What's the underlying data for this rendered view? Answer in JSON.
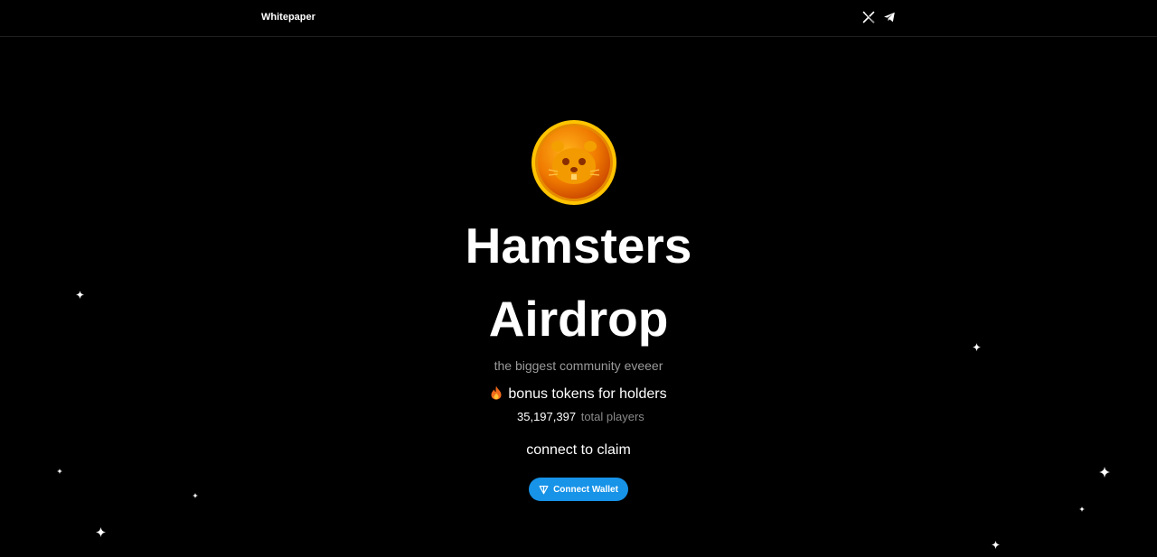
{
  "nav": {
    "whitepaper_label": "Whitepaper",
    "social": [
      {
        "icon": "x-icon"
      },
      {
        "icon": "telegram-icon"
      }
    ]
  },
  "hero": {
    "logo_icon": "hamster-coin-icon",
    "title_line1": "Hamsters",
    "title_line2": "Airdrop",
    "subtitle": "the biggest community eveeer",
    "bonus_icon": "fire-icon",
    "bonus_text": "bonus tokens for holders",
    "players_count": "35,197,397",
    "players_label": "total players",
    "claim_text": "connect to claim",
    "connect_button_label": "Connect Wallet",
    "connect_button_icon": "ton-icon"
  },
  "colors": {
    "background": "#000000",
    "button": "#1793e8",
    "muted_text": "#9a9a9a",
    "coin_gold": "#f5a800",
    "coin_orange": "#e25c00"
  }
}
